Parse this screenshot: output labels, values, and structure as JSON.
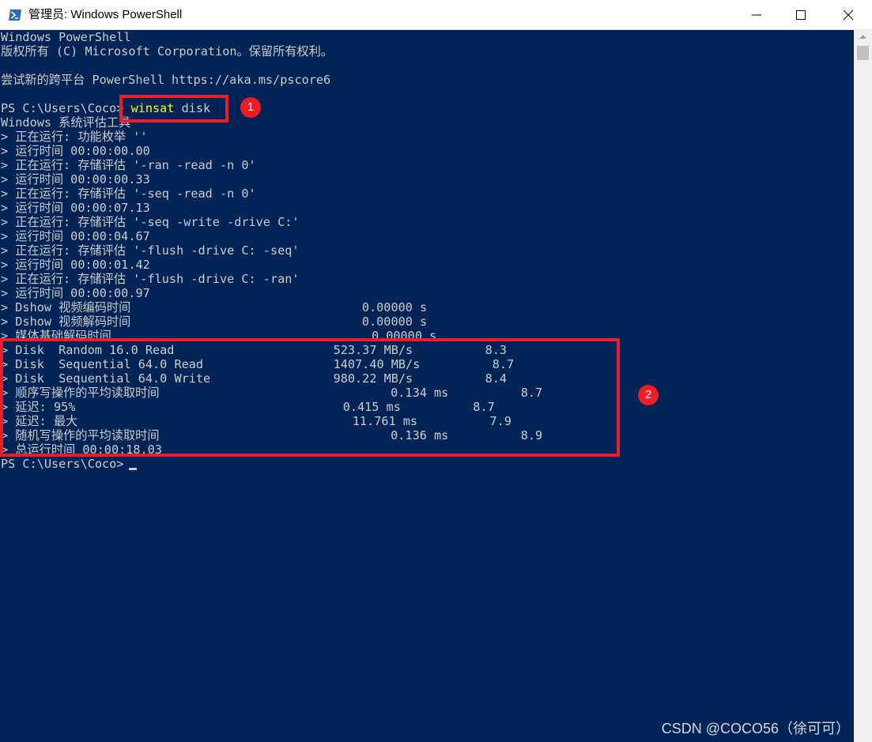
{
  "window": {
    "title": "管理员: Windows PowerShell"
  },
  "console": {
    "lines": [
      "Windows PowerShell",
      "版权所有 (C) Microsoft Corporation。保留所有权利。",
      "",
      "尝试新的跨平台 PowerShell https://aka.ms/pscore6",
      "",
      "",
      "Windows 系统评估工具",
      "> 正在运行: 功能枚举 ''",
      "> 运行时间 00:00:00.00",
      "> 正在运行: 存储评估 '-ran -read -n 0'",
      "> 运行时间 00:00:00.33",
      "> 正在运行: 存储评估 '-seq -read -n 0'",
      "> 运行时间 00:00:07.13",
      "> 正在运行: 存储评估 '-seq -write -drive C:'",
      "> 运行时间 00:00:04.67",
      "> 正在运行: 存储评估 '-flush -drive C: -seq'",
      "> 运行时间 00:00:01.42",
      "> 正在运行: 存储评估 '-flush -drive C: -ran'",
      "> 运行时间 00:00:00.97",
      "> Dshow 视频编码时间                                0.00000 s",
      "> Dshow 视频解码时间                                0.00000 s",
      "> 媒体基础解码时间                                    0.00000 s",
      "> Disk  Random 16.0 Read                      523.37 MB/s          8.3",
      "> Disk  Sequential 64.0 Read                  1407.40 MB/s          8.7",
      "> Disk  Sequential 64.0 Write                 980.22 MB/s          8.4",
      "> 顺序写操作的平均读取时间                                0.134 ms          8.7",
      "> 延迟: 95%                                     0.415 ms          8.7",
      "> 延迟: 最大                                      11.761 ms          7.9",
      "> 随机写操作的平均读取时间                                0.136 ms          8.9",
      "> 总运行时间 00:00:18.03"
    ],
    "command_prompt": "PS C:\\Users\\Coco> ",
    "command_keyword": "winsat",
    "command_args": " disk",
    "final_prompt": "PS C:\\Users\\Coco> "
  },
  "annotations": {
    "badge_1": "1",
    "badge_2": "2",
    "color": "#ee1c25"
  },
  "watermark": "CSDN @COCO56（徐可可）",
  "colors": {
    "console_bg": "#012456",
    "console_text": "#cccccc",
    "command_highlight": "#ffff00"
  }
}
